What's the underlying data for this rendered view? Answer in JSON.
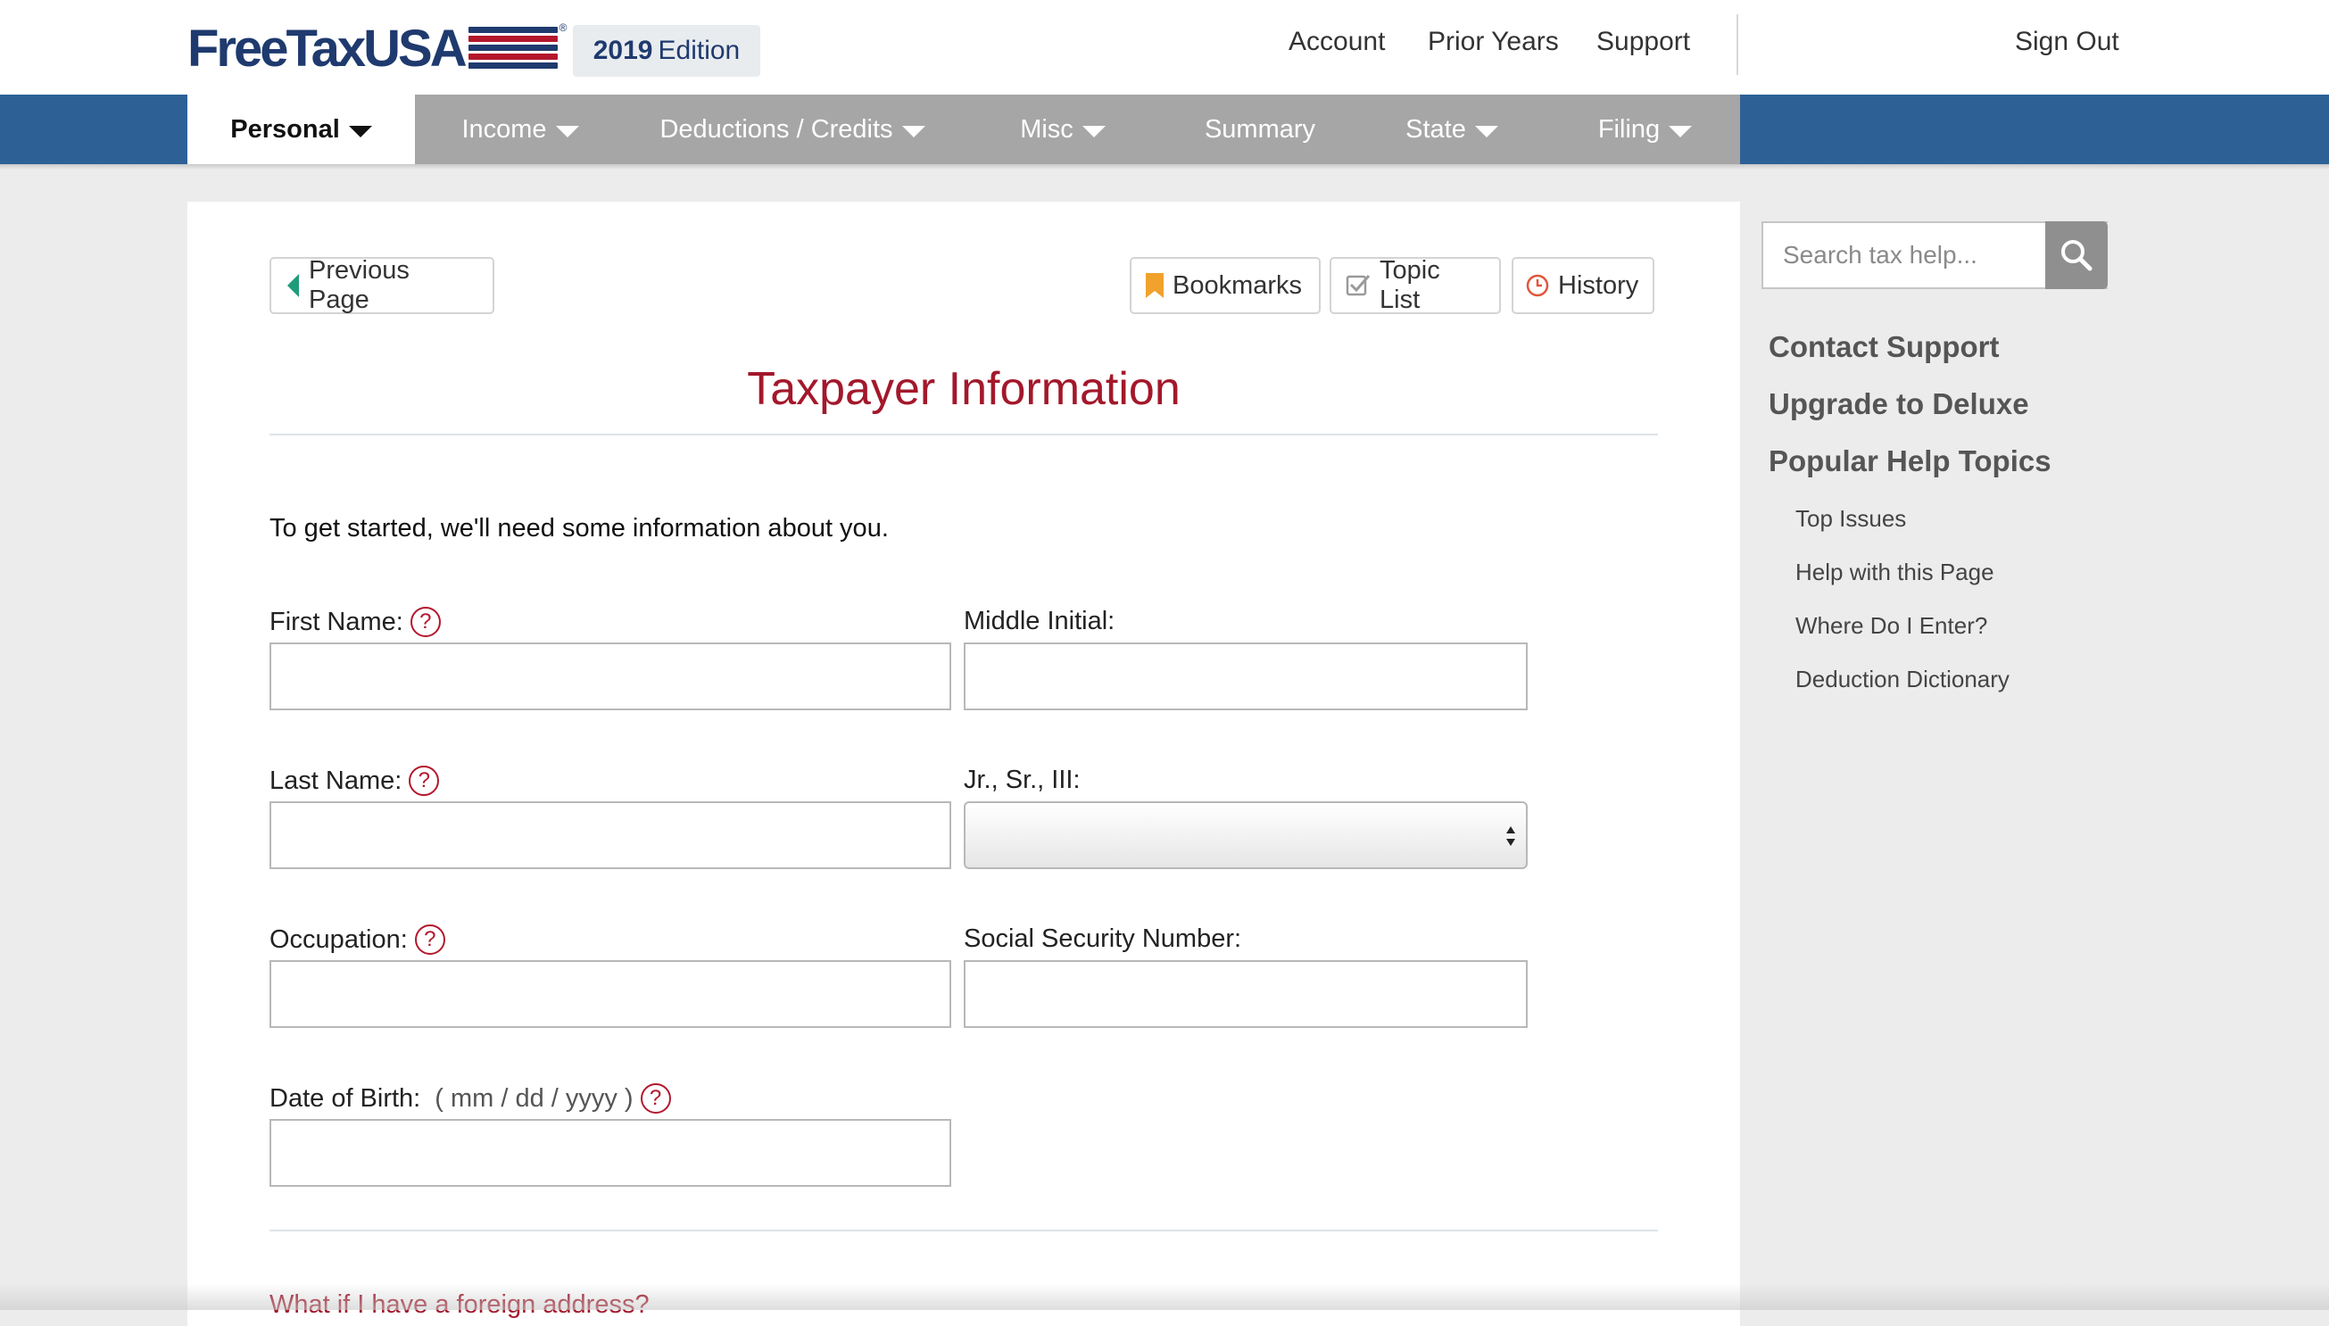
{
  "header": {
    "logo": {
      "text": "FreeTaxUSA",
      "registered": "®"
    },
    "edition": {
      "year": "2019",
      "label": "Edition"
    },
    "links": [
      "Account",
      "Prior Years",
      "Support"
    ],
    "signout": "Sign Out"
  },
  "nav": {
    "tabs": [
      {
        "label": "Personal",
        "caret": true,
        "active": true
      },
      {
        "label": "Income",
        "caret": true
      },
      {
        "label": "Deductions / Credits",
        "caret": true
      },
      {
        "label": "Misc",
        "caret": true
      },
      {
        "label": "Summary",
        "caret": false
      },
      {
        "label": "State",
        "caret": true
      },
      {
        "label": "Filing",
        "caret": true
      }
    ]
  },
  "toolbar": {
    "previous": "Previous Page",
    "bookmarks": "Bookmarks",
    "topic_list": "Topic List",
    "history": "History"
  },
  "page": {
    "title": "Taxpayer Information",
    "intro": "To get started, we'll need some information about you.",
    "foreign_link": "What if I have a foreign address?"
  },
  "form": {
    "first_name": {
      "label": "First Name:",
      "value": ""
    },
    "middle_initial": {
      "label": "Middle Initial:",
      "value": ""
    },
    "last_name": {
      "label": "Last Name:",
      "value": ""
    },
    "suffix": {
      "label": "Jr., Sr., III:",
      "value": ""
    },
    "occupation": {
      "label": "Occupation:",
      "value": ""
    },
    "ssn": {
      "label": "Social Security Number:",
      "value": ""
    },
    "dob": {
      "label": "Date of Birth:",
      "hint": "( mm / dd / yyyy )",
      "value": ""
    },
    "help_glyph": "?"
  },
  "sidebar": {
    "search_placeholder": "Search tax help...",
    "links": [
      "Contact Support",
      "Upgrade to Deluxe",
      "Popular Help Topics"
    ],
    "topics": [
      "Top Issues",
      "Help with this Page",
      "Where Do I Enter?",
      "Deduction Dictionary"
    ]
  },
  "colors": {
    "brand_navy": "#1f3a6e",
    "brand_red": "#b3182d",
    "nav_blue": "#2d6196",
    "title_red": "#a3182b"
  }
}
